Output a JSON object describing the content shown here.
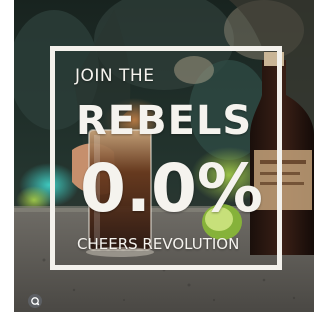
{
  "poster": {
    "line1": "JOIN THE",
    "line2": "REBELS",
    "line3": "0.0%",
    "line4": "CHEERS REVOLUTION"
  },
  "colors": {
    "text": "#f5f3ee",
    "background_dark": "#20302c",
    "accent_teal": "#2aa7a0",
    "accent_green": "#9bc33a"
  },
  "icons": {
    "lens": "google-lens-icon"
  }
}
